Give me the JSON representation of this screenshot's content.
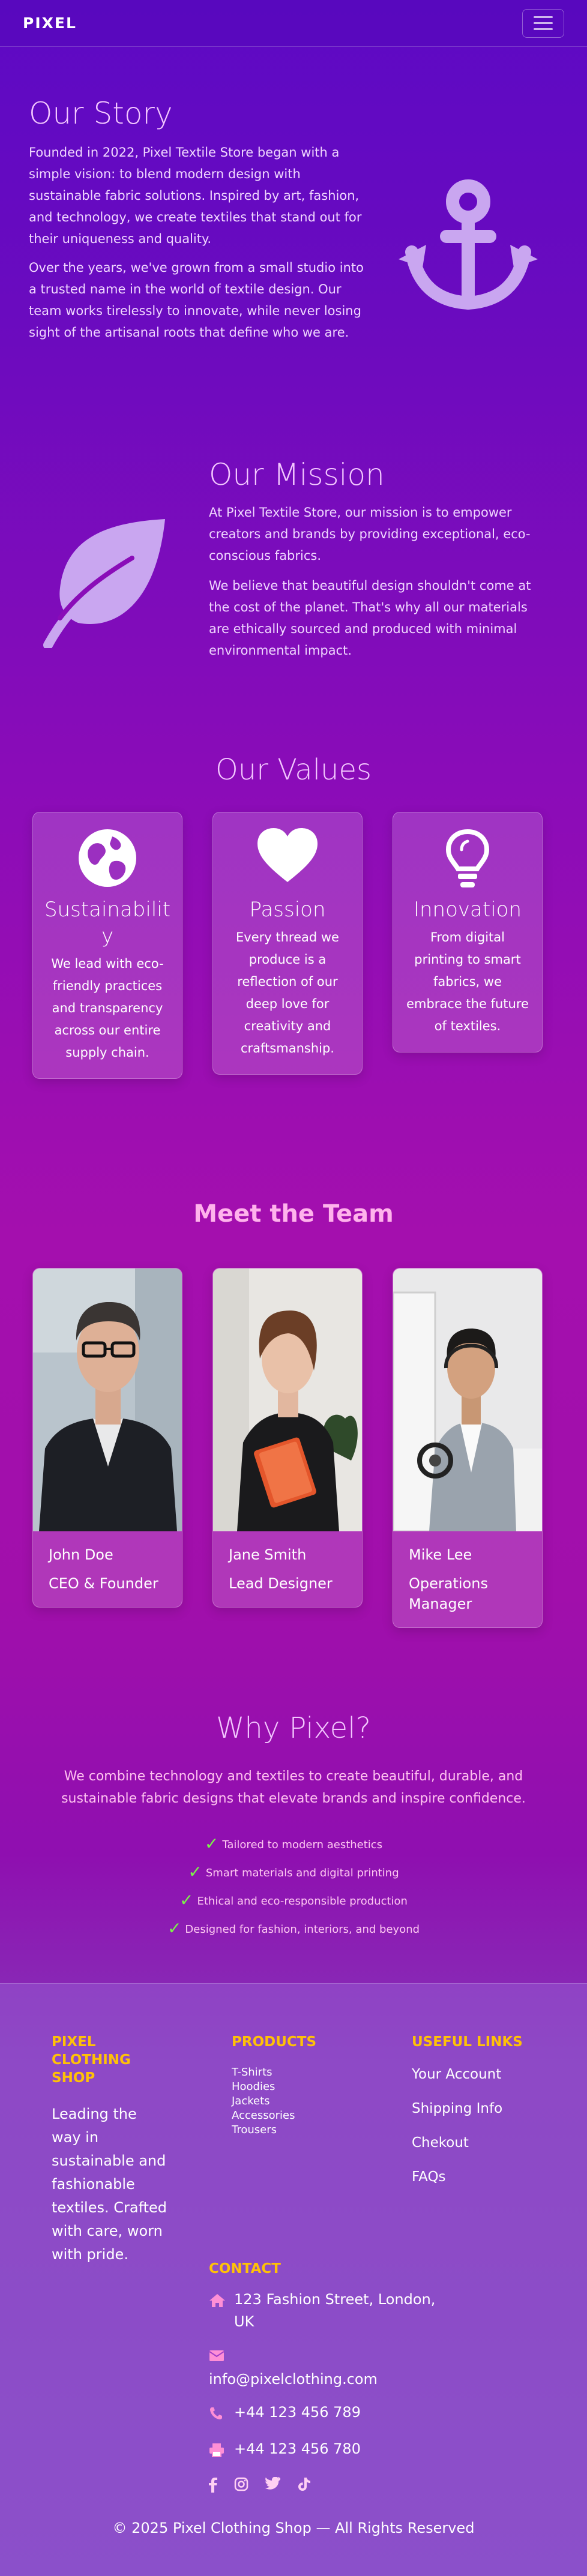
{
  "nav": {
    "brand": "PIXEL",
    "menu_icon": "hamburger-icon"
  },
  "story": {
    "title": "Our Story",
    "paragraphs": [
      "Founded in 2022, Pixel Textile Store began with a simple vision: to blend modern design with sustainable fabric solutions. Inspired by art, fashion, and technology, we create textiles that stand out for their uniqueness and quality.",
      "Over the years, we've grown from a small studio into a trusted name in the world of textile design. Our team works tirelessly to innovate, while never losing sight of the artisanal roots that define who we are."
    ],
    "icon": "anchor-icon"
  },
  "mission": {
    "title": "Our Mission",
    "paragraphs": [
      "At Pixel Textile Store, our mission is to empower creators and brands by providing exceptional, eco-conscious fabrics.",
      "We believe that beautiful design shouldn't come at the cost of the planet. That's why all our materials are ethically sourced and produced with minimal environmental impact."
    ],
    "icon": "leaf-icon"
  },
  "values": {
    "title": "Our Values",
    "items": [
      {
        "title": "Sustainability",
        "text": "We lead with eco-friendly practices and transparency across our entire supply chain.",
        "icon": "globe-icon"
      },
      {
        "title": "Passion",
        "text": "Every thread we produce is a reflection of our deep love for creativity and craftsmanship.",
        "icon": "heart-icon"
      },
      {
        "title": "Innovation",
        "text": "From digital printing to smart fabrics, we embrace the future of textiles.",
        "icon": "lightbulb-icon"
      }
    ]
  },
  "team": {
    "title": "Meet the Team",
    "members": [
      {
        "name": "John Doe",
        "role": "CEO & Founder"
      },
      {
        "name": "Jane Smith",
        "role": "Lead Designer"
      },
      {
        "name": "Mike Lee",
        "role": "Operations Manager"
      }
    ]
  },
  "why": {
    "title": "Why Pixel?",
    "text": "We combine technology and textiles to create beautiful, durable, and sustainable fabric designs that elevate brands and inspire confidence.",
    "points": [
      "Tailored to modern aesthetics",
      "Smart materials and digital printing",
      "Ethical and eco-responsible production",
      "Designed for fashion, interiors, and beyond"
    ]
  },
  "footer": {
    "shop": {
      "heading": "PIXEL CLOTHING SHOP",
      "description": "Leading the way in sustainable and fashionable textiles. Crafted with care, worn with pride."
    },
    "products": {
      "heading": "PRODUCTS",
      "items": [
        "T-Shirts",
        "Hoodies",
        "Jackets",
        "Accessories",
        "Trousers"
      ]
    },
    "useful_links": {
      "heading": "USEFUL LINKS",
      "items": [
        "Your Account",
        "Shipping Info",
        "Chekout",
        "FAQs"
      ]
    },
    "contact": {
      "heading": "CONTACT",
      "address": "123 Fashion Street, London, UK",
      "email": "info@pixelclothing.com",
      "phone": "+44 123 456 789",
      "fax": "+44 123 456 780"
    },
    "socials": [
      "facebook-icon",
      "instagram-icon",
      "twitter-icon",
      "tiktok-icon"
    ],
    "copyright": "© 2025 Pixel Clothing Shop — All Rights Reserved"
  },
  "colors": {
    "accent_heading": "#f3c7ff",
    "footer_heading": "#ffc107",
    "check": "#7cf34a",
    "icon_fill": "#c9a6f0"
  }
}
